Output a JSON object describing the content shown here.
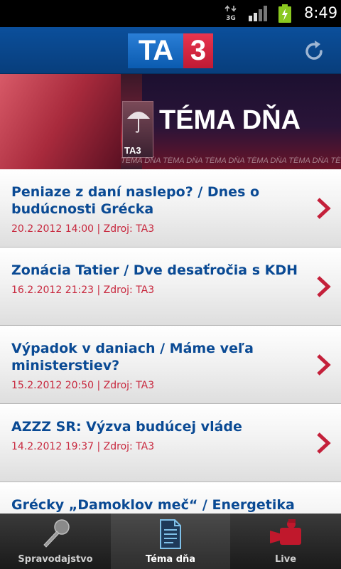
{
  "status_bar": {
    "network": "3G",
    "time": "8:49"
  },
  "header": {
    "logo_left": "TA",
    "logo_right": "3"
  },
  "banner": {
    "title": "TÉMA DŇA",
    "badge": "TA3",
    "strip": "TÉMA DŇA   TÉMA DŇA   TÉMA DŇA   TÉMA DŇA   TÉMA DŇA   TÉMA DŇA"
  },
  "articles": [
    {
      "title": "Peniaze z daní naslepo? / Dnes o budúcnosti Grécka",
      "meta": "20.2.2012 14:00 | Zdroj: TA3"
    },
    {
      "title": "Zonácia Tatier / Dve desaťročia s KDH",
      "meta": "16.2.2012 21:23 | Zdroj: TA3"
    },
    {
      "title": "Výpadok v daniach / Máme veľa ministerstiev?",
      "meta": "15.2.2012 20:50 | Zdroj: TA3"
    },
    {
      "title": "AZZZ SR: Výzva budúcej vláde",
      "meta": "14.2.2012 19:37 | Zdroj: TA3"
    },
    {
      "title": "Grécky „Damoklov meč“ / Energetika v",
      "meta": ""
    }
  ],
  "tabs": [
    {
      "label": "Spravodajstvo",
      "icon": "microphone-icon"
    },
    {
      "label": "Téma dňa",
      "icon": "document-icon"
    },
    {
      "label": "Live",
      "icon": "video-camera-icon"
    }
  ],
  "colors": {
    "header_blue": "#0b4f9b",
    "headline_blue": "#0a4a94",
    "meta_red": "#c8283e",
    "chevron_red": "#c4203a"
  }
}
